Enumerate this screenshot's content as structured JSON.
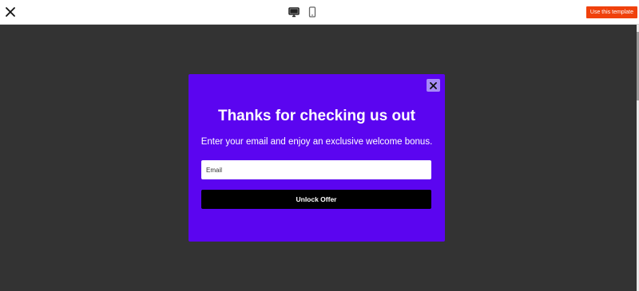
{
  "toolbar": {
    "close_icon": "close-icon",
    "desktop_icon": "desktop-icon",
    "mobile_icon": "mobile-icon",
    "use_template_label": "Use this template",
    "accent_color": "#f0410c"
  },
  "popup": {
    "close_icon": "close-icon",
    "title": "Thanks for checking us out",
    "subtitle": "Enter your email and enjoy an exclusive welcome bonus.",
    "email_placeholder": "Email",
    "cta_label": "Unlock Offer",
    "background_color": "#5b05f0",
    "button_color": "#000000"
  }
}
